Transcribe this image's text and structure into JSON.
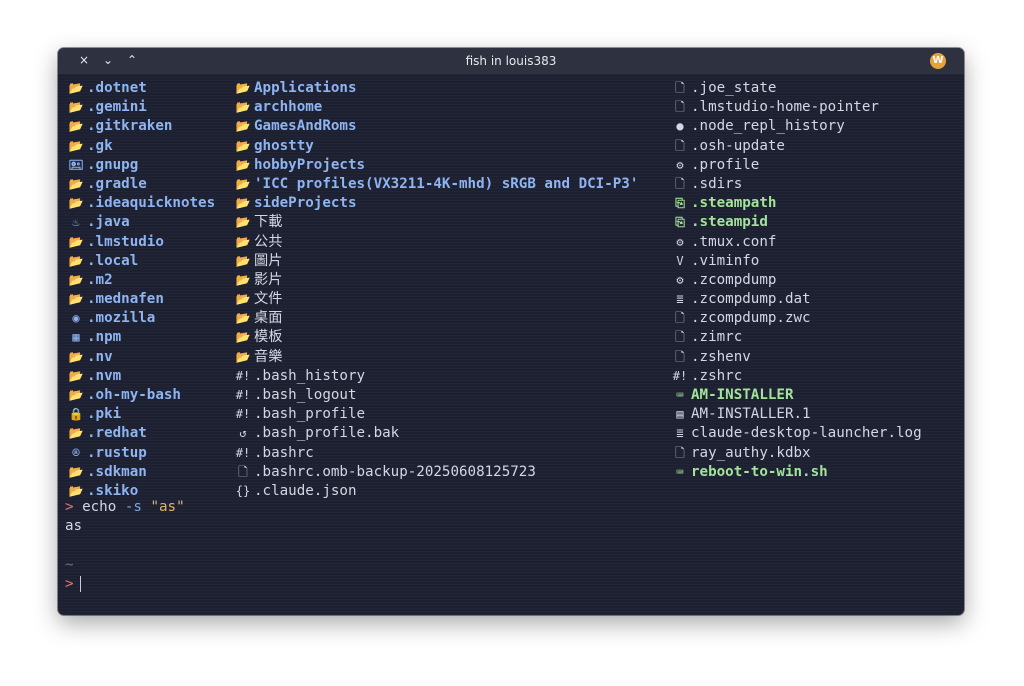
{
  "window": {
    "title": "fish in louis383",
    "app_badge": "W"
  },
  "titlebar_controls": [
    "×",
    "⌄",
    "⌃"
  ],
  "columns": [
    [
      {
        "name": ".dotnet",
        "kind": "dir",
        "icon": "📂"
      },
      {
        "name": ".gemini",
        "kind": "dir",
        "icon": "📂"
      },
      {
        "name": ".gitkraken",
        "kind": "dir",
        "icon": "📂"
      },
      {
        "name": ".gk",
        "kind": "dir",
        "icon": "📂"
      },
      {
        "name": ".gnupg",
        "kind": "dir",
        "icon": "🖭"
      },
      {
        "name": ".gradle",
        "kind": "dir",
        "icon": "📂"
      },
      {
        "name": ".ideaquicknotes",
        "kind": "dir",
        "icon": "📂"
      },
      {
        "name": ".java",
        "kind": "dir",
        "icon": "♨"
      },
      {
        "name": ".lmstudio",
        "kind": "dir",
        "icon": "📂"
      },
      {
        "name": ".local",
        "kind": "dir",
        "icon": "📂"
      },
      {
        "name": ".m2",
        "kind": "dir",
        "icon": "📂"
      },
      {
        "name": ".mednafen",
        "kind": "dir",
        "icon": "📂"
      },
      {
        "name": ".mozilla",
        "kind": "dir",
        "icon": "◉"
      },
      {
        "name": ".npm",
        "kind": "dir",
        "icon": "▦"
      },
      {
        "name": ".nv",
        "kind": "dir",
        "icon": "📂"
      },
      {
        "name": ".nvm",
        "kind": "dir",
        "icon": "📂"
      },
      {
        "name": ".oh-my-bash",
        "kind": "dir",
        "icon": "📂"
      },
      {
        "name": ".pki",
        "kind": "dir",
        "icon": "🔒"
      },
      {
        "name": ".redhat",
        "kind": "dir",
        "icon": "📂"
      },
      {
        "name": ".rustup",
        "kind": "dir",
        "icon": "®"
      },
      {
        "name": ".sdkman",
        "kind": "dir",
        "icon": "📂"
      },
      {
        "name": ".skiko",
        "kind": "dir",
        "icon": "📂"
      }
    ],
    [
      {
        "name": "Applications",
        "kind": "dir",
        "icon": "📂"
      },
      {
        "name": "archhome",
        "kind": "dir",
        "icon": "📂"
      },
      {
        "name": "GamesAndRoms",
        "kind": "dir",
        "icon": "📂"
      },
      {
        "name": "ghostty",
        "kind": "dir",
        "icon": "📂"
      },
      {
        "name": "hobbyProjects",
        "kind": "dir",
        "icon": "📂"
      },
      {
        "name": "'ICC profiles(VX3211-4K-mhd) sRGB and DCI-P3'",
        "kind": "dir",
        "icon": "📂"
      },
      {
        "name": "sideProjects",
        "kind": "dir",
        "icon": "📂"
      },
      {
        "name": "下載",
        "kind": "file",
        "icon": "📂"
      },
      {
        "name": "公共",
        "kind": "file",
        "icon": "📂"
      },
      {
        "name": "圖片",
        "kind": "file",
        "icon": "📂"
      },
      {
        "name": "影片",
        "kind": "file",
        "icon": "📂"
      },
      {
        "name": "文件",
        "kind": "file",
        "icon": "📂"
      },
      {
        "name": "桌面",
        "kind": "file",
        "icon": "📂"
      },
      {
        "name": "模板",
        "kind": "file",
        "icon": "📂"
      },
      {
        "name": "音樂",
        "kind": "file",
        "icon": "📂"
      },
      {
        "name": ".bash_history",
        "kind": "file",
        "icon": "#!"
      },
      {
        "name": ".bash_logout",
        "kind": "file",
        "icon": "#!"
      },
      {
        "name": ".bash_profile",
        "kind": "file",
        "icon": "#!"
      },
      {
        "name": ".bash_profile.bak",
        "kind": "file",
        "icon": "↺"
      },
      {
        "name": ".bashrc",
        "kind": "file",
        "icon": "#!"
      },
      {
        "name": ".bashrc.omb-backup-20250608125723",
        "kind": "file",
        "icon": "🗋"
      },
      {
        "name": ".claude.json",
        "kind": "file",
        "icon": "{}"
      }
    ],
    [
      {
        "name": ".joe_state",
        "kind": "file",
        "icon": "🗋"
      },
      {
        "name": ".lmstudio-home-pointer",
        "kind": "file",
        "icon": "🗋"
      },
      {
        "name": ".node_repl_history",
        "kind": "file",
        "icon": "●"
      },
      {
        "name": ".osh-update",
        "kind": "file",
        "icon": "🗋"
      },
      {
        "name": ".profile",
        "kind": "file",
        "icon": "⚙"
      },
      {
        "name": ".sdirs",
        "kind": "file",
        "icon": "🗋"
      },
      {
        "name": ".steampath",
        "kind": "exec",
        "icon": "⎘"
      },
      {
        "name": ".steampid",
        "kind": "exec",
        "icon": "⎘"
      },
      {
        "name": ".tmux.conf",
        "kind": "file",
        "icon": "⚙"
      },
      {
        "name": ".viminfo",
        "kind": "file",
        "icon": "V"
      },
      {
        "name": ".zcompdump",
        "kind": "file",
        "icon": "⚙"
      },
      {
        "name": ".zcompdump.dat",
        "kind": "file",
        "icon": "≣"
      },
      {
        "name": ".zcompdump.zwc",
        "kind": "file",
        "icon": "🗋"
      },
      {
        "name": ".zimrc",
        "kind": "file",
        "icon": "🗋"
      },
      {
        "name": ".zshenv",
        "kind": "file",
        "icon": "🗋"
      },
      {
        "name": ".zshrc",
        "kind": "file",
        "icon": "#!"
      },
      {
        "name": "AM-INSTALLER",
        "kind": "exec",
        "icon": "⌨"
      },
      {
        "name": "AM-INSTALLER.1",
        "kind": "file",
        "icon": "▤"
      },
      {
        "name": "claude-desktop-launcher.log",
        "kind": "file",
        "icon": "≣"
      },
      {
        "name": "ray_authy.kdbx",
        "kind": "file",
        "icon": "🗋"
      },
      {
        "name": "reboot-to-win.sh",
        "kind": "exec",
        "icon": "⌨"
      }
    ]
  ],
  "shell": {
    "prompt_symbol": ">",
    "command": "echo",
    "flag": "-s",
    "argument": "\"as\"",
    "output": "as",
    "cwd_marker": "~"
  }
}
